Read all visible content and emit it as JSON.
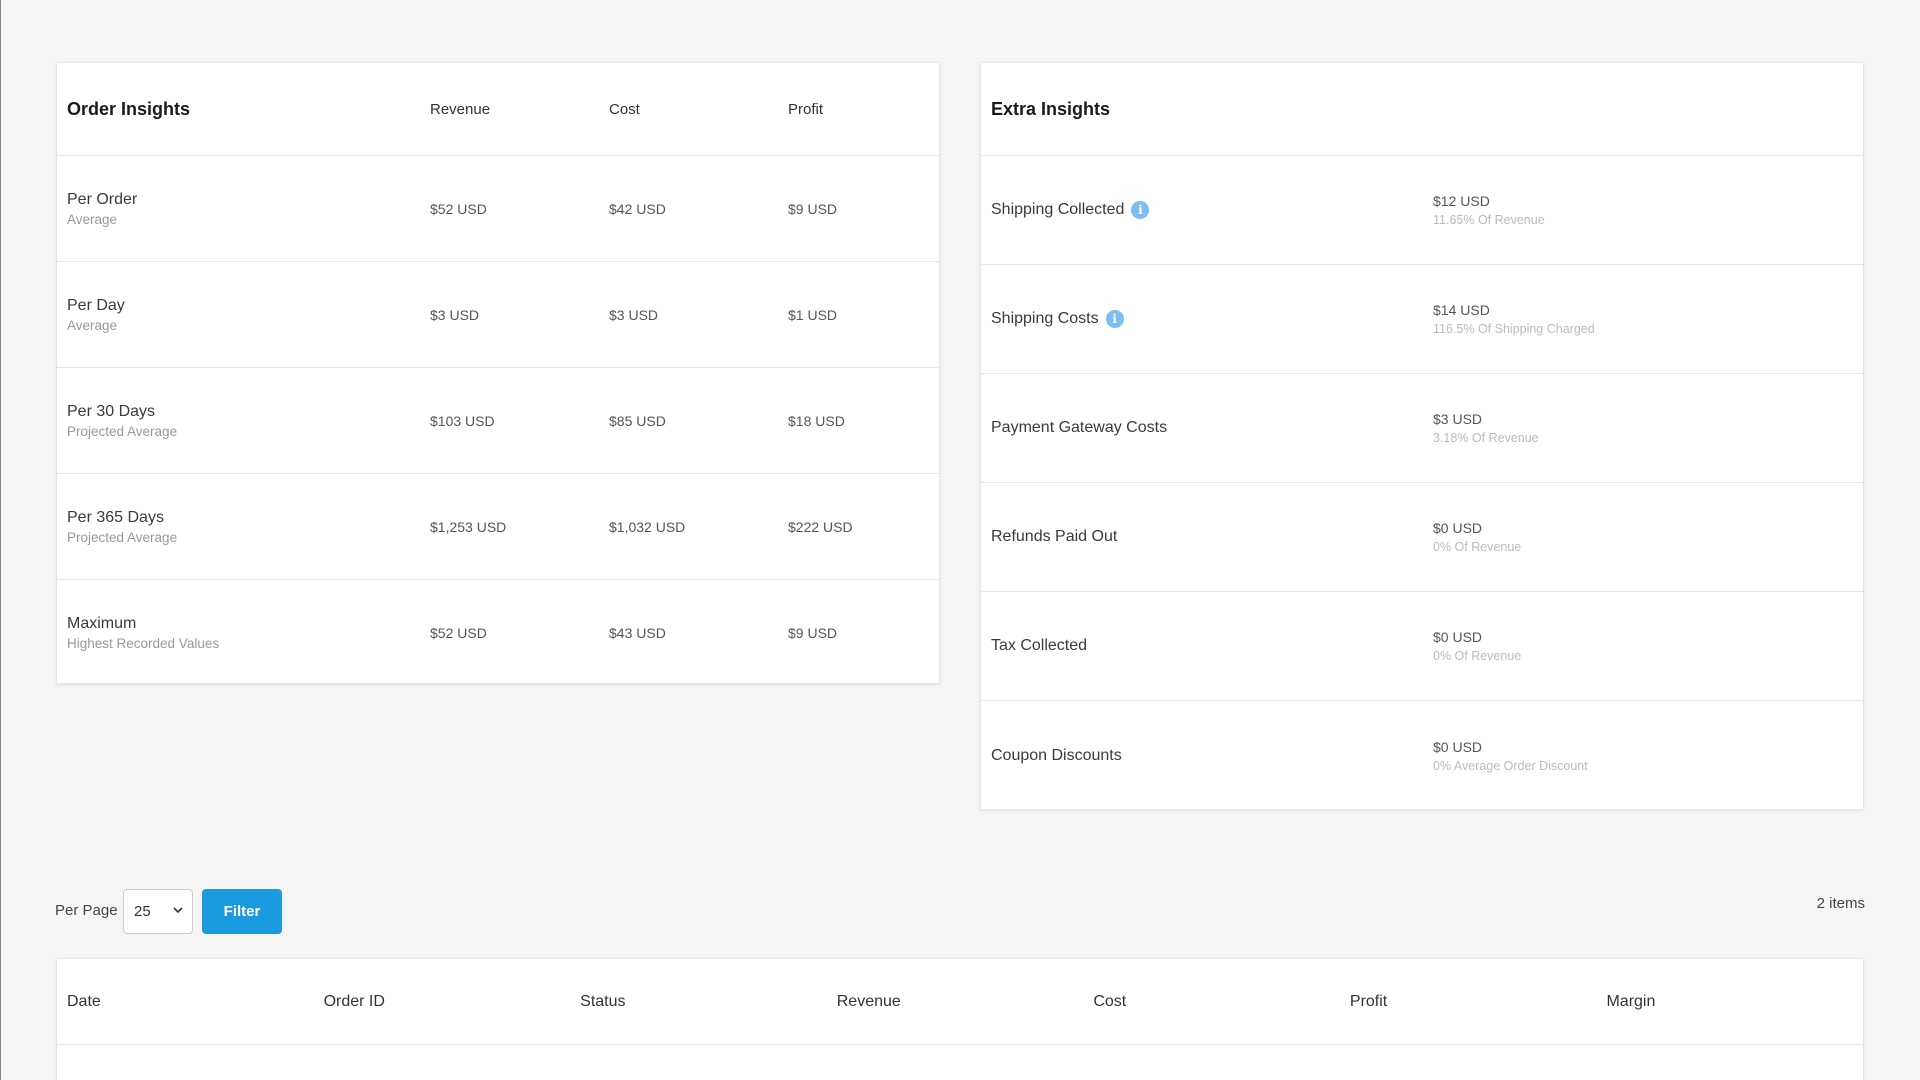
{
  "order_insights": {
    "title": "Order Insights",
    "columns": [
      "Revenue",
      "Cost",
      "Profit"
    ],
    "rows": [
      {
        "label": "Per Order",
        "sub": "Average",
        "revenue": "$52 USD",
        "cost": "$42 USD",
        "profit": "$9 USD"
      },
      {
        "label": "Per Day",
        "sub": "Average",
        "revenue": "$3 USD",
        "cost": "$3 USD",
        "profit": "$1 USD"
      },
      {
        "label": "Per 30 Days",
        "sub": "Projected Average",
        "revenue": "$103 USD",
        "cost": "$85 USD",
        "profit": "$18 USD"
      },
      {
        "label": "Per 365 Days",
        "sub": "Projected Average",
        "revenue": "$1,253 USD",
        "cost": "$1,032 USD",
        "profit": "$222 USD"
      },
      {
        "label": "Maximum",
        "sub": "Highest Recorded Values",
        "revenue": "$52 USD",
        "cost": "$43 USD",
        "profit": "$9 USD"
      }
    ]
  },
  "extra_insights": {
    "title": "Extra Insights",
    "rows": [
      {
        "label": "Shipping Collected",
        "info_icon": "i",
        "value": "$12 USD",
        "sub": "11.65% Of Revenue"
      },
      {
        "label": "Shipping Costs",
        "info_icon": "i",
        "value": "$14 USD",
        "sub": "116.5% Of Shipping Charged"
      },
      {
        "label": "Payment Gateway Costs",
        "value": "$3 USD",
        "sub": "3.18% Of Revenue"
      },
      {
        "label": "Refunds Paid Out",
        "value": "$0 USD",
        "sub": "0% Of Revenue"
      },
      {
        "label": "Tax Collected",
        "value": "$0 USD",
        "sub": "0% Of Revenue"
      },
      {
        "label": "Coupon Discounts",
        "value": "$0 USD",
        "sub": "0% Average Order Discount"
      }
    ]
  },
  "filter_bar": {
    "per_page_label": "Per Page",
    "per_page_value": "25",
    "filter_label": "Filter",
    "items_count": "2 items"
  },
  "orders_table": {
    "columns": [
      "Date",
      "Order ID",
      "Status",
      "Revenue",
      "Cost",
      "Profit",
      "Margin"
    ]
  },
  "colors": {
    "accent": "#1a9be0",
    "info_icon": "#7dbdf0",
    "background": "#f5f5f5"
  }
}
